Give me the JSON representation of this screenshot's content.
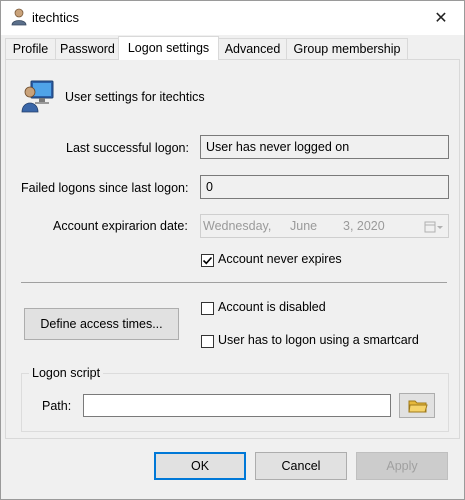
{
  "window": {
    "title": "itechtics",
    "close_glyph": "✕",
    "icon": "user-icon"
  },
  "tabs": [
    {
      "label": "Profile",
      "active": false
    },
    {
      "label": "Password",
      "active": false
    },
    {
      "label": "Logon settings",
      "active": true
    },
    {
      "label": "Advanced",
      "active": false
    },
    {
      "label": "Group membership",
      "active": false
    }
  ],
  "header": {
    "icon": "user-computer-icon",
    "text": "User settings for itechtics"
  },
  "fields": {
    "last_logon_label": "Last successful logon:",
    "last_logon_value": "User has never logged on",
    "failed_logons_label": "Failed logons since last logon:",
    "failed_logons_value": "0",
    "expiration_label": "Account expirarion date:",
    "expiration_weekday": "Wednesday,",
    "expiration_month": "June",
    "expiration_day_year": "3, 2020",
    "expiration_picker_icon": "calendar-dropdown-icon"
  },
  "checkboxes": {
    "never_expires": {
      "label": "Account never expires",
      "checked": true
    },
    "disabled": {
      "label": "Account is disabled",
      "checked": false
    },
    "smartcard": {
      "label": "User has to logon using a smartcard",
      "checked": false
    }
  },
  "buttons": {
    "define_access_times": "Define access times...",
    "ok": "OK",
    "cancel": "Cancel",
    "apply": "Apply"
  },
  "logon_script": {
    "group_title": "Logon script",
    "path_label": "Path:",
    "path_value": "",
    "browse_icon": "folder-icon"
  },
  "colors": {
    "accent": "#0078d7",
    "folder": "#f0c040"
  }
}
